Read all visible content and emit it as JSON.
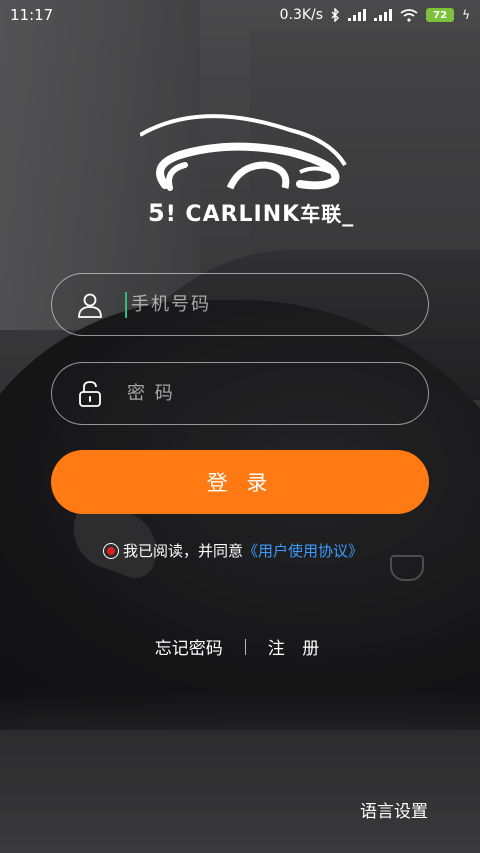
{
  "status_bar": {
    "time": "11:17",
    "network_speed": "0.3K/s",
    "battery_level": "72"
  },
  "logo": {
    "brand_number": "5",
    "brand_text": "CARLINK",
    "brand_cn": "车联"
  },
  "login_form": {
    "phone_placeholder": "手机号码",
    "password_placeholder": "密 码",
    "login_label": "登 录"
  },
  "agreement": {
    "text": "我已阅读，并同意",
    "link": "《用户使用协议》",
    "radio_color": "#e02020",
    "link_color": "#3b9bff"
  },
  "links": {
    "forgot_password": "忘记密码",
    "register": "注 册"
  },
  "language_setting": "语言设置",
  "colors": {
    "accent": "#ff7a12"
  }
}
